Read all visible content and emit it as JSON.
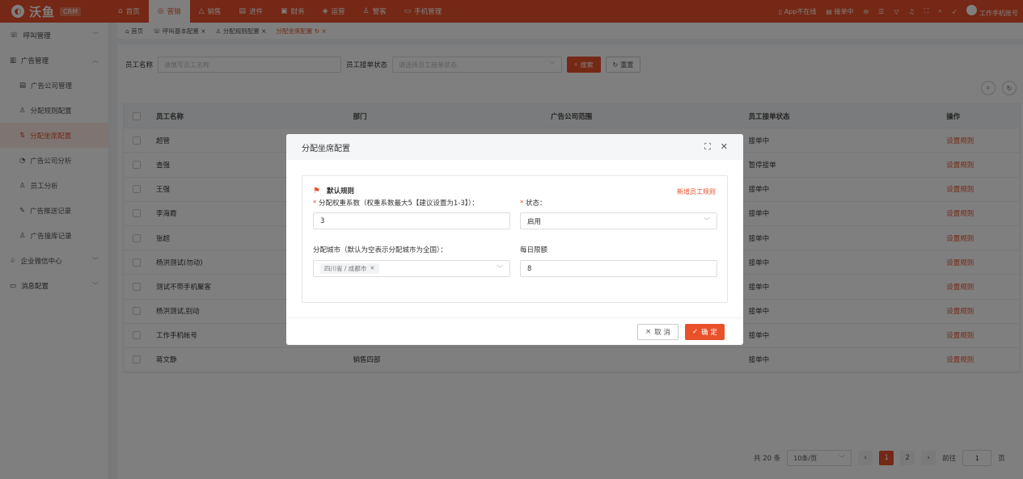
{
  "brand": {
    "name": "沃鱼",
    "tag": "CRM"
  },
  "nav": [
    {
      "icon": "⌂",
      "label": "首页",
      "active": false
    },
    {
      "icon": "◎",
      "label": "营销",
      "active": true
    },
    {
      "icon": "△",
      "label": "销售",
      "active": false
    },
    {
      "icon": "▤",
      "label": "进件",
      "active": false
    },
    {
      "icon": "▣",
      "label": "财务",
      "active": false
    },
    {
      "icon": "◈",
      "label": "运营",
      "active": false
    },
    {
      "icon": "♙",
      "label": "警客",
      "active": false
    },
    {
      "icon": "▭",
      "label": "手机管理",
      "active": false
    }
  ],
  "topright": {
    "app_status": "App不在线",
    "order_status": "接单中",
    "account": "工作手机账号"
  },
  "sidebar": [
    {
      "label": "呼叫管理",
      "icon": "☏",
      "level": 0,
      "chev": "﹀"
    },
    {
      "label": "广告管理",
      "icon": "▥",
      "level": 0,
      "chev": "︿"
    },
    {
      "label": "广告公司管理",
      "icon": "▤",
      "level": 1
    },
    {
      "label": "分配规则配置",
      "icon": "♙",
      "level": 1
    },
    {
      "label": "分配坐席配置",
      "icon": "⇅",
      "level": 1,
      "active": true
    },
    {
      "label": "广告公司分析",
      "icon": "◔",
      "level": 1
    },
    {
      "label": "员工分析",
      "icon": "♙",
      "level": 1
    },
    {
      "label": "广告推送记录",
      "icon": "✎",
      "level": 1
    },
    {
      "label": "广告撞库记录",
      "icon": "♙",
      "level": 1
    },
    {
      "label": "企业微信中心",
      "icon": "♧",
      "level": 0,
      "chev": "﹀"
    },
    {
      "label": "消息配置",
      "icon": "▭",
      "level": 0,
      "chev": "﹀"
    }
  ],
  "tabs": [
    {
      "label": "⌂ 首页",
      "active": false
    },
    {
      "label": "☏ 呼叫基本配置 ×",
      "active": false
    },
    {
      "label": "♙ 分配规则配置 ×",
      "active": false
    },
    {
      "label": "分配坐席配置 ↻ ×",
      "active": true
    }
  ],
  "filters": {
    "name_label": "员工名称",
    "name_placeholder": "请填写员工名称",
    "status_label": "员工接单状态",
    "status_placeholder": "请选择员工接单状态",
    "search": "搜索",
    "reset": "重置"
  },
  "table": {
    "headers": [
      "员工名称",
      "部门",
      "广告公司范围",
      "员工接单状态",
      "操作"
    ],
    "rows": [
      [
        "超管",
        "",
        "",
        "接单中",
        "设置规则"
      ],
      [
        "查强",
        "",
        "",
        "暂停接单",
        "设置规则"
      ],
      [
        "王强",
        "",
        "",
        "接单中",
        "设置规则"
      ],
      [
        "李海霞",
        "",
        "",
        "接单中",
        "设置规则"
      ],
      [
        "张超",
        "",
        "",
        "接单中",
        "设置规则"
      ],
      [
        "杨洪测试(勿动)",
        "",
        "",
        "接单中",
        "设置规则"
      ],
      [
        "测试不带手机聚客",
        "",
        "",
        "接单中",
        "设置规则"
      ],
      [
        "杨洪测试,别动",
        "",
        "",
        "接单中",
        "设置规则"
      ],
      [
        "工作手机帐号",
        "",
        "",
        "接单中",
        "设置规则"
      ],
      [
        "蒋文静",
        "销售四部",
        "",
        "接单中",
        "设置规则"
      ]
    ]
  },
  "pager": {
    "total": "共 20 条",
    "size": "10条/页",
    "pages": [
      "1",
      "2"
    ],
    "goto_label": "前往",
    "goto_value": "1",
    "goto_unit": "页"
  },
  "modal": {
    "title": "分配坐席配置",
    "rule_title": "默认规则",
    "new_rule": "新增员工规则",
    "weight_label": "分配权重系数（权重系数最大5【建议设置为1-3】）：",
    "weight_value": "3",
    "status_label": "状态：",
    "status_value": "启用",
    "city_label": "分配城市（默认为空表示分配城市为全国）：",
    "city_tag": "四川省 / 成都市",
    "limit_label": "每日限额",
    "limit_value": "8",
    "cancel": "取 消",
    "confirm": "确 定"
  }
}
